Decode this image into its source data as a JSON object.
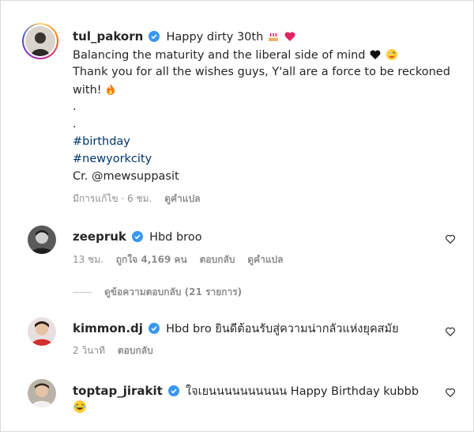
{
  "post": {
    "username": "tul_pakorn",
    "caption_first": "Happy dirty 30th",
    "caption_lines": [
      "Balancing the maturity and the liberal side of mind",
      "Thank you for all the wishes guys, Y'all are a force to be reckoned",
      "with!",
      ".",
      "."
    ],
    "hashtags": [
      "#birthday",
      "#newyorkcity"
    ],
    "credit": "Cr. @mewsuppasit",
    "meta_time": "มีการแก้ไข · 6 ชม.",
    "meta_translate": "ดูคำแปล"
  },
  "comments": [
    {
      "username": "zeepruk",
      "text": "Hbd broo",
      "time": "13 ชม.",
      "likes": "ถูกใจ 4,169 คน",
      "reply": "ตอบกลับ",
      "translate": "ดูคำแปล"
    },
    {
      "username": "kimmon.dj",
      "text": "Hbd bro ยินดีต้อนรับสู่ความน่ากลัวแห่งยุคสมัย",
      "time": "2 วินาที",
      "reply": "ตอบกลับ"
    },
    {
      "username": "toptap_jirakit",
      "text": "ใจเยนนนนนนนนนน Happy Birthday kubbb"
    }
  ],
  "view_replies": "ดูข้อความตอบกลับ (21 รายการ)",
  "colors": {
    "verified": "#3897f0",
    "link": "#00376b",
    "meta": "#8e8e8e"
  }
}
